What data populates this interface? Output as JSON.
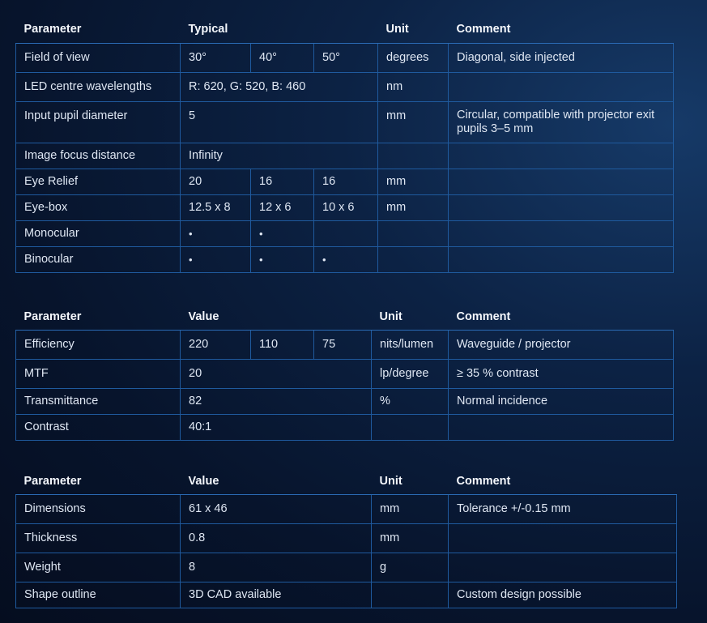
{
  "table1": {
    "headers": [
      "Parameter",
      "Typical",
      "Unit",
      "Comment"
    ],
    "rows": {
      "fov": {
        "label": "Field of view",
        "v1": "30°",
        "v2": "40°",
        "v3": "50°",
        "unit": "degrees",
        "comment": "Diagonal, side injected"
      },
      "led": {
        "label": "LED centre wavelengths",
        "value": "R: 620, G: 520, B: 460",
        "unit": "nm",
        "comment": ""
      },
      "pupil": {
        "label": "Input pupil diameter",
        "value": "5",
        "unit": "mm",
        "comment": "Circular, compatible with projector exit pupils 3–5 mm"
      },
      "focus": {
        "label": "Image focus distance",
        "value": "Infinity",
        "unit": "",
        "comment": ""
      },
      "relief": {
        "label": "Eye Relief",
        "v1": "20",
        "v2": "16",
        "v3": "16",
        "unit": "mm",
        "comment": ""
      },
      "eyebox": {
        "label": "Eye-box",
        "v1": "12.5 x 8",
        "v2": "12 x 6",
        "v3": "10 x 6",
        "unit": "mm",
        "comment": ""
      },
      "mono": {
        "label": "Monocular",
        "v1": "•",
        "v2": "•",
        "v3": "",
        "unit": "",
        "comment": ""
      },
      "bino": {
        "label": "Binocular",
        "v1": "•",
        "v2": "•",
        "v3": "•",
        "unit": "",
        "comment": ""
      }
    }
  },
  "table2": {
    "headers": [
      "Parameter",
      "Value",
      "Unit",
      "Comment"
    ],
    "rows": {
      "eff": {
        "label": "Efficiency",
        "v1": "220",
        "v2": "110",
        "v3": "75",
        "unit": "nits/lumen",
        "comment": "Waveguide / projector"
      },
      "mtf": {
        "label": "MTF",
        "value": "20",
        "unit": "lp/degree",
        "comment": "≥ 35 % contrast"
      },
      "trans": {
        "label": "Transmittance",
        "value": "82",
        "unit": "%",
        "comment": "Normal incidence"
      },
      "contrast": {
        "label": "Contrast",
        "value": "40:1",
        "unit": "",
        "comment": ""
      }
    }
  },
  "table3": {
    "headers": [
      "Parameter",
      "Value",
      "Unit",
      "Comment"
    ],
    "rows": {
      "dim": {
        "label": "Dimensions",
        "value": "61 x 46",
        "unit": "mm",
        "comment": "Tolerance +/-0.15 mm"
      },
      "thick": {
        "label": "Thickness",
        "value": "0.8",
        "unit": "mm",
        "comment": ""
      },
      "weight": {
        "label": "Weight",
        "value": "8",
        "unit": "g",
        "comment": ""
      },
      "shape": {
        "label": "Shape outline",
        "value": "3D CAD available",
        "unit": "",
        "comment": "Custom design possible"
      }
    }
  }
}
